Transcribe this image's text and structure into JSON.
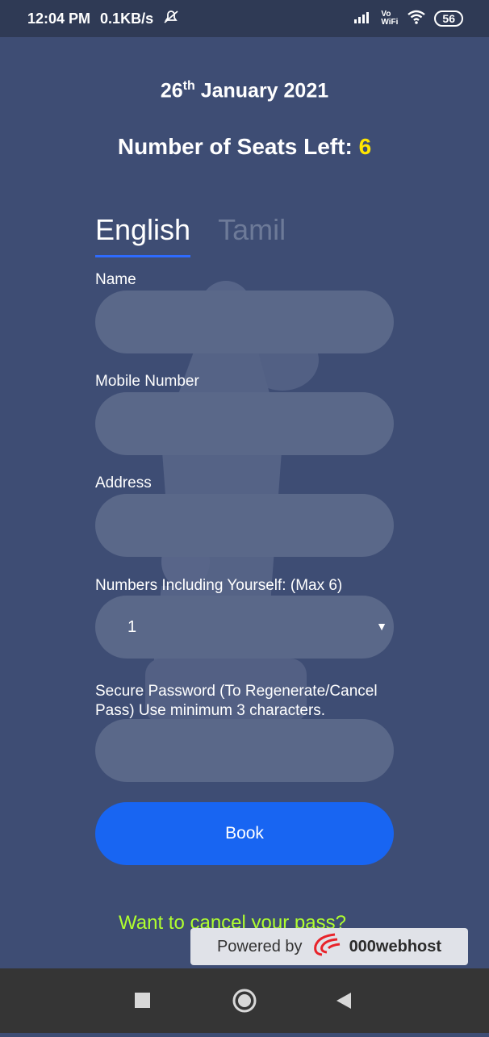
{
  "status": {
    "time": "12:04 PM",
    "speed": "0.1KB/s",
    "network_label": "Vo WiFi",
    "battery": "56"
  },
  "header": {
    "date_day": "26",
    "date_suffix": "th",
    "date_rest": " January 2021",
    "seats_label": "Number of Seats Left: ",
    "seats_count": "6"
  },
  "tabs": [
    {
      "label": "English",
      "active": true
    },
    {
      "label": "Tamil",
      "active": false
    }
  ],
  "form": {
    "name_label": "Name",
    "name_value": "",
    "mobile_label": "Mobile Number",
    "mobile_value": "",
    "address_label": "Address",
    "address_value": "",
    "numbers_label": "Numbers Including Yourself: (Max 6)",
    "numbers_value": "1",
    "password_label": "Secure Password (To Regenerate/Cancel Pass) Use minimum 3 characters.",
    "password_value": "",
    "book_label": "Book"
  },
  "footer": {
    "cancel_link": "Want to cancel your pass?",
    "powered_by": "Powered by",
    "brand": "000webhost"
  },
  "colors": {
    "background": "#3e4d74",
    "accent": "#1865f2",
    "seats_highlight": "#ffe500",
    "link": "#b0ff2f"
  }
}
